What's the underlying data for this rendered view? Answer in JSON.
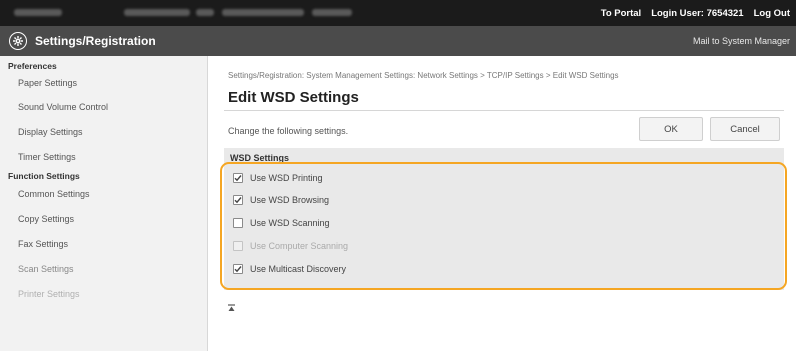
{
  "topbar": {
    "portal_link": "To Portal",
    "login_user": "Login User: 7654321",
    "logout_link": "Log Out"
  },
  "header": {
    "title": "Settings/Registration",
    "mail_link": "Mail to System Manager"
  },
  "sidebar": {
    "sections": [
      {
        "heading": "Preferences",
        "items": [
          "Paper Settings",
          "Sound Volume Control",
          "Display Settings",
          "Timer Settings"
        ]
      },
      {
        "heading": "Function Settings",
        "items": [
          "Common Settings",
          "Copy Settings",
          "Fax Settings",
          "Scan Settings",
          "Printer Settings"
        ]
      }
    ]
  },
  "main": {
    "breadcrumb": "Settings/Registration: System Management Settings: Network Settings > TCP/IP Settings > Edit WSD Settings",
    "title": "Edit WSD Settings",
    "instruction": "Change the following settings.",
    "ok_label": "OK",
    "cancel_label": "Cancel",
    "section_title": "WSD Settings",
    "options": [
      {
        "label": "Use WSD Printing",
        "checked": true,
        "enabled": true
      },
      {
        "label": "Use WSD Browsing",
        "checked": true,
        "enabled": true
      },
      {
        "label": "Use WSD Scanning",
        "checked": false,
        "enabled": true
      },
      {
        "label": "Use Computer Scanning",
        "checked": false,
        "enabled": false
      },
      {
        "label": "Use Multicast Discovery",
        "checked": true,
        "enabled": true
      }
    ]
  },
  "colors": {
    "highlight": "#f5a623",
    "topbar": "#1b1b1b",
    "titlebar": "#4b4b4b"
  }
}
